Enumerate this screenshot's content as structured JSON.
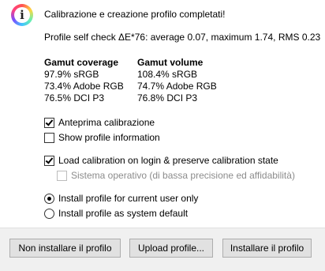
{
  "header": {
    "icon": "info-icon",
    "title": "Calibrazione e creazione profilo completati!"
  },
  "self_check": "Profile self check ΔE*76: average 0.07, maximum 1.74, RMS 0.23",
  "gamut": {
    "coverage": {
      "title": "Gamut coverage",
      "rows": [
        "97.9% sRGB",
        "73.4% Adobe RGB",
        "76.5% DCI P3"
      ]
    },
    "volume": {
      "title": "Gamut volume",
      "rows": [
        "108.4% sRGB",
        "74.7% Adobe RGB",
        "76.8% DCI P3"
      ]
    }
  },
  "options": {
    "preview_calibration": {
      "label": "Anteprima calibrazione",
      "checked": true
    },
    "show_profile_info": {
      "label": "Show profile information",
      "checked": false
    },
    "load_calibration": {
      "label": "Load calibration on login & preserve calibration state",
      "checked": true
    },
    "os_option": {
      "label": "Sistema operativo (di bassa precisione ed affidabilità)",
      "checked": false,
      "enabled": false
    }
  },
  "install_scope": {
    "current_user": {
      "label": "Install profile for current user only",
      "selected": true
    },
    "system_default": {
      "label": "Install profile as system default",
      "selected": false
    }
  },
  "buttons": {
    "dont_install": "Non installare il profilo",
    "upload": "Upload profile...",
    "install": "Installare il profilo"
  }
}
